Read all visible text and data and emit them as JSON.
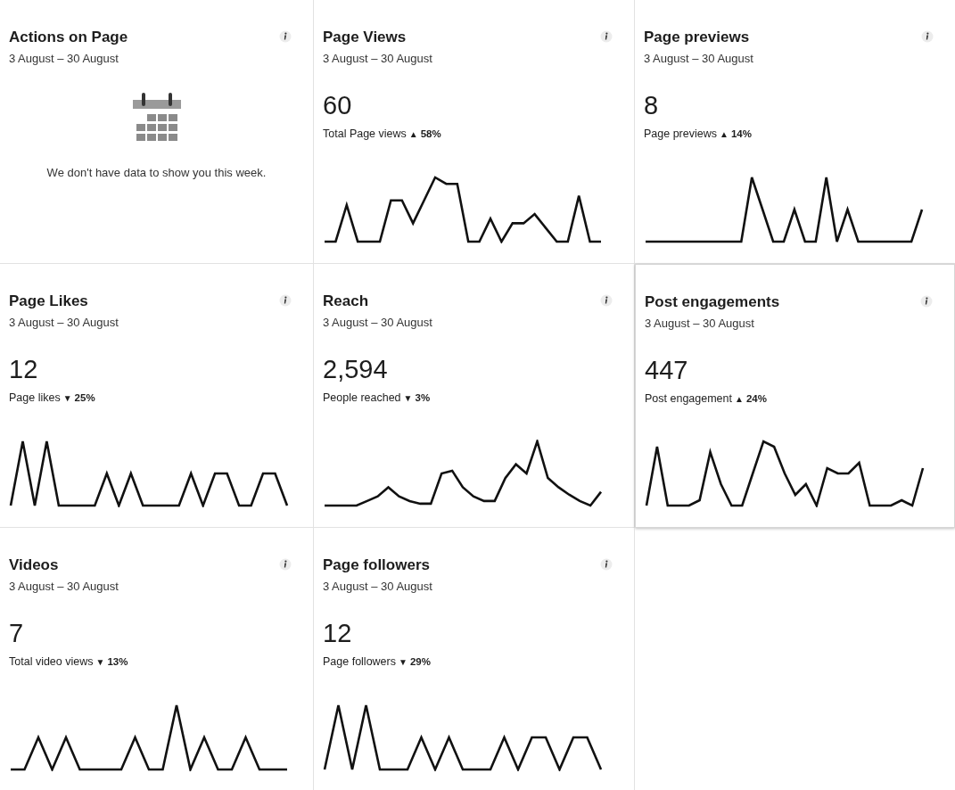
{
  "cards": [
    {
      "kind": "empty",
      "title": "Actions on Page",
      "date_range": "3 August – 30 August",
      "message": "We don't have data to show you this week."
    },
    {
      "kind": "metric",
      "title": "Page Views",
      "date_range": "3 August – 30 August",
      "value": "60",
      "metric_label": "Total Page views",
      "trend": "▲",
      "change": "58%"
    },
    {
      "kind": "metric",
      "title": "Page previews",
      "date_range": "3 August – 30 August",
      "value": "8",
      "metric_label": "Page previews",
      "trend": "▲",
      "change": "14%"
    },
    {
      "kind": "metric",
      "title": "Page Likes",
      "date_range": "3 August – 30 August",
      "value": "12",
      "metric_label": "Page likes",
      "trend": "▼",
      "change": "25%"
    },
    {
      "kind": "metric",
      "title": "Reach",
      "date_range": "3 August – 30 August",
      "value": "2,594",
      "metric_label": "People reached",
      "trend": "▼",
      "change": "3%"
    },
    {
      "kind": "metric",
      "title": "Post engagements",
      "date_range": "3 August – 30 August",
      "value": "447",
      "metric_label": "Post engagement",
      "trend": "▲",
      "change": "24%",
      "selected": true
    },
    {
      "kind": "metric",
      "title": "Videos",
      "date_range": "3 August – 30 August",
      "value": "7",
      "metric_label": "Total video views",
      "trend": "▼",
      "change": "13%"
    },
    {
      "kind": "metric",
      "title": "Page followers",
      "date_range": "3 August – 30 August",
      "value": "12",
      "metric_label": "Page followers",
      "trend": "▼",
      "change": "29%"
    }
  ]
}
